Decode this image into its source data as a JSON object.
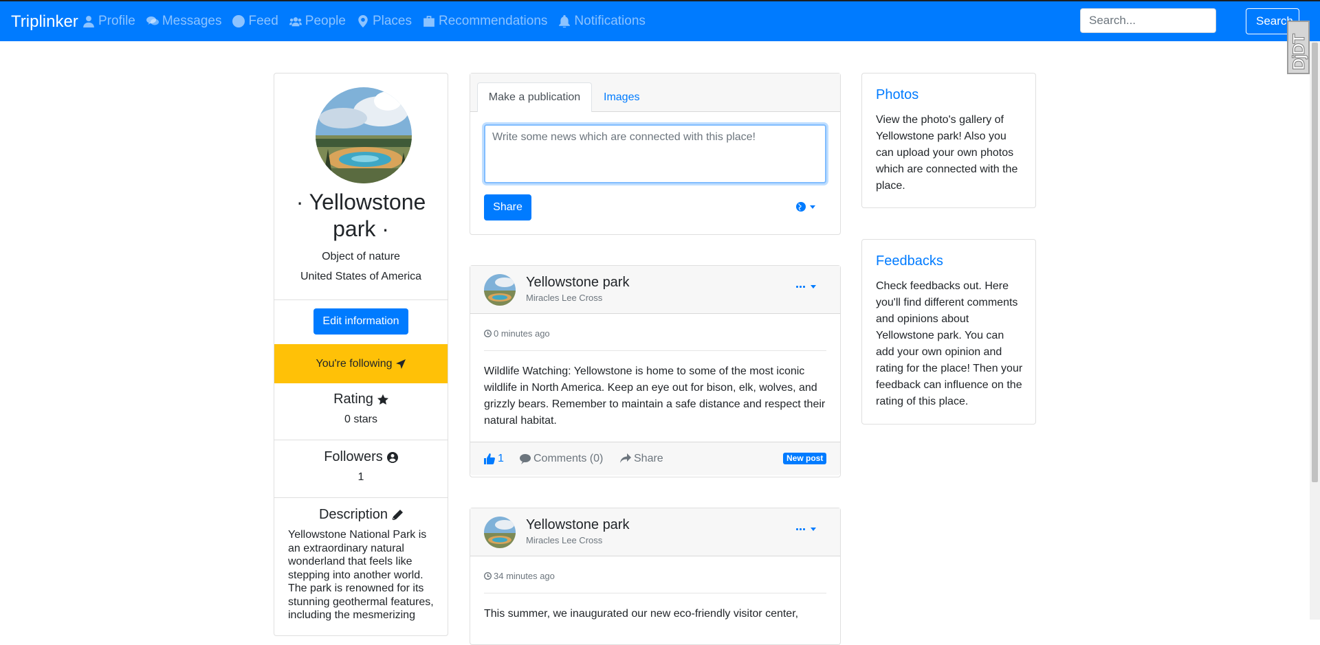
{
  "navbar": {
    "brand": "Triplinker",
    "items": [
      {
        "label": "Profile",
        "icon": "user-icon"
      },
      {
        "label": "Messages",
        "icon": "comments-icon"
      },
      {
        "label": "Feed",
        "icon": "globe-icon"
      },
      {
        "label": "People",
        "icon": "users-icon"
      },
      {
        "label": "Places",
        "icon": "map-marker-icon"
      },
      {
        "label": "Recommendations",
        "icon": "briefcase-icon"
      },
      {
        "label": "Notifications",
        "icon": "bell-icon"
      }
    ],
    "search_placeholder": "Search...",
    "search_button": "Search",
    "badge": "DjDT"
  },
  "profile": {
    "name_line1": "· Yellowstone",
    "name_line2": "park ·",
    "type": "Object of nature",
    "country": "United States of America",
    "edit_label": "Edit information",
    "follow_label": "You're following",
    "rating_title": "Rating",
    "rating_value": "0 stars",
    "followers_title": "Followers",
    "followers_value": "1",
    "description_title": "Description",
    "description_text": "Yellowstone National Park is an extraordinary natural wonderland that feels like stepping into another world. The park is renowned for its stunning geothermal features, including the mesmerizing"
  },
  "composer": {
    "tab_active": "Make a publication",
    "tab_images": "Images",
    "placeholder": "Write some news which are connected with this place!",
    "share_label": "Share"
  },
  "posts": [
    {
      "title": "Yellowstone park",
      "author": "Miracles Lee Cross",
      "time": "0 minutes ago",
      "body": "Wildlife Watching: Yellowstone is home to some of the most iconic wildlife in North America. Keep an eye out for bison, elk, wolves, and grizzly bears. Remember to maintain a safe distance and respect their natural habitat.",
      "likes": "1",
      "comments": "Comments (0)",
      "share": "Share",
      "badge": "New post"
    },
    {
      "title": "Yellowstone park",
      "author": "Miracles Lee Cross",
      "time": "34 minutes ago",
      "body": "This summer, we inaugurated our new eco-friendly visitor center,"
    }
  ],
  "cards": {
    "photos_title": "Photos",
    "photos_text": "View the photo's gallery of Yellowstone park! Also you can upload your own photos which are connected with the place.",
    "feedbacks_title": "Feedbacks",
    "feedbacks_text": "Check feedbacks out. Here you'll find different comments and opinions about Yellowstone park. You can add your own opinion and rating for the place! Then your feedback can influence on the rating of this place."
  }
}
